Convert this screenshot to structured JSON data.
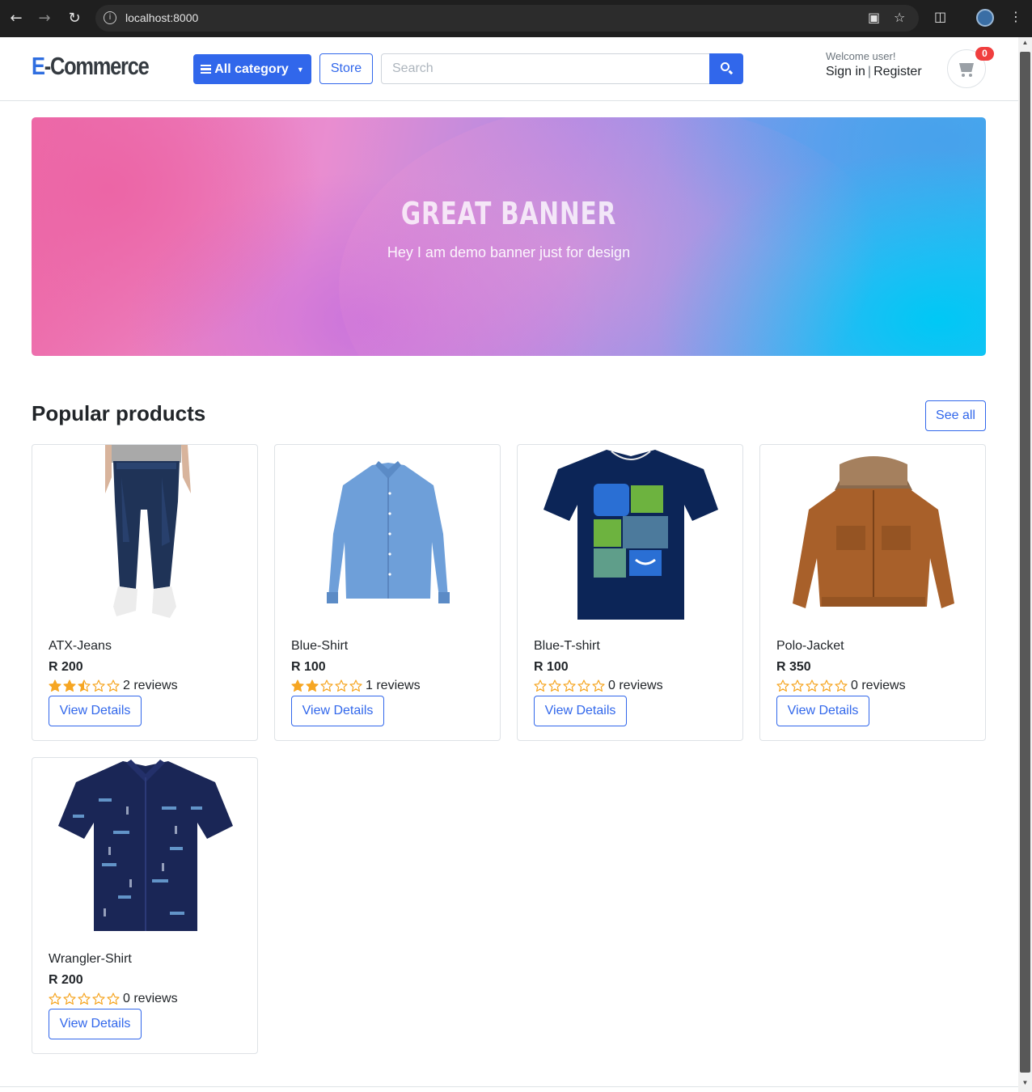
{
  "browser": {
    "url": "localhost:8000"
  },
  "header": {
    "logo_first": "E",
    "logo_rest": "-Commerce",
    "category_label": "All category",
    "store_label": "Store",
    "search_placeholder": "Search",
    "welcome": "Welcome user!",
    "sign_in": "Sign in",
    "separator": "|",
    "register": "Register",
    "cart_count": "0"
  },
  "banner": {
    "title": "GREAT BANNER",
    "subtitle": "Hey I am demo banner just for design"
  },
  "section": {
    "title": "Popular products",
    "see_all": "See all"
  },
  "products": [
    {
      "name": "ATX-Jeans",
      "price": "R 200",
      "rating": 2.5,
      "reviews": "2 reviews",
      "button": "View Details",
      "image_icon": "jeans-icon"
    },
    {
      "name": "Blue-Shirt",
      "price": "R 100",
      "rating": 2,
      "reviews": "1 reviews",
      "button": "View Details",
      "image_icon": "shirt-icon"
    },
    {
      "name": "Blue-T-shirt",
      "price": "R 100",
      "rating": 0,
      "reviews": "0 reviews",
      "button": "View Details",
      "image_icon": "tshirt-icon"
    },
    {
      "name": "Polo-Jacket",
      "price": "R 350",
      "rating": 0,
      "reviews": "0 reviews",
      "button": "View Details",
      "image_icon": "jacket-icon"
    },
    {
      "name": "Wrangler-Shirt",
      "price": "R 200",
      "rating": 0,
      "reviews": "0 reviews",
      "button": "View Details",
      "image_icon": "printed-shirt-icon"
    }
  ],
  "colors": {
    "primary": "#3167eb",
    "star": "#f6a623",
    "badge": "#f03e3e"
  }
}
